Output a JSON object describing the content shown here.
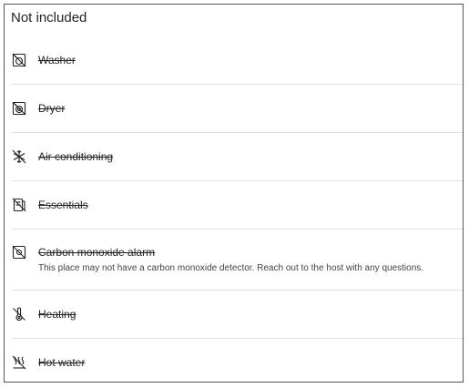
{
  "section": {
    "title": "Not included"
  },
  "items": [
    {
      "label": "Washer",
      "icon": "washer-off-icon"
    },
    {
      "label": "Dryer",
      "icon": "dryer-off-icon"
    },
    {
      "label": "Air conditioning",
      "icon": "snowflake-off-icon"
    },
    {
      "label": "Essentials",
      "icon": "essentials-off-icon"
    },
    {
      "label": "Carbon monoxide alarm",
      "description": "This place may not have a carbon monoxide detector. Reach out to the host with any questions.",
      "icon": "co-alarm-off-icon"
    },
    {
      "label": "Heating",
      "icon": "thermometer-off-icon"
    },
    {
      "label": "Hot water",
      "icon": "hot-water-off-icon"
    }
  ]
}
